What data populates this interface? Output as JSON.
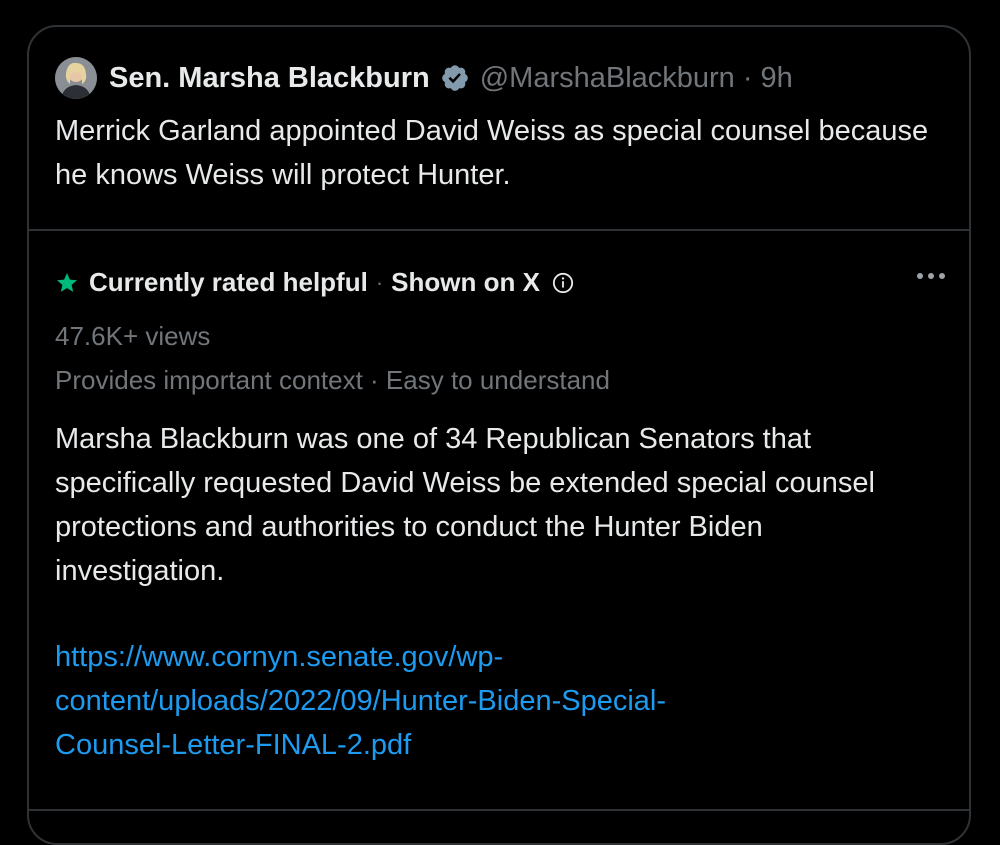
{
  "tweet": {
    "display_name": "Sen. Marsha Blackburn",
    "handle": "@MarshaBlackburn",
    "separator": "·",
    "time": "9h",
    "verified_icon": "verified-badge-icon",
    "text": "Merrick Garland appointed David Weiss as special counsel because he knows Weiss will protect Hunter."
  },
  "community_note": {
    "status": "Currently rated helpful",
    "separator": "·",
    "shown_on": "Shown on X",
    "views": "47.6K+ views",
    "tags": "Provides important context · Easy to understand",
    "text": "Marsha Blackburn was one of 34 Republican Senators that specifically requested David Weiss be extended special counsel protections and authorities to conduct the Hunter Biden investigation.",
    "link_line1": "https://www.cornyn.senate.gov/wp-",
    "link_line2": "content/uploads/2022/09/Hunter-Biden-Special-",
    "link_line3": "Counsel-Letter-FINAL-2.pdf"
  },
  "colors": {
    "background": "#000000",
    "text_primary": "#e7e9ea",
    "text_secondary": "#71767b",
    "link": "#1d9bf0",
    "helpful_star": "#00ba7c",
    "border": "#2f3336"
  }
}
